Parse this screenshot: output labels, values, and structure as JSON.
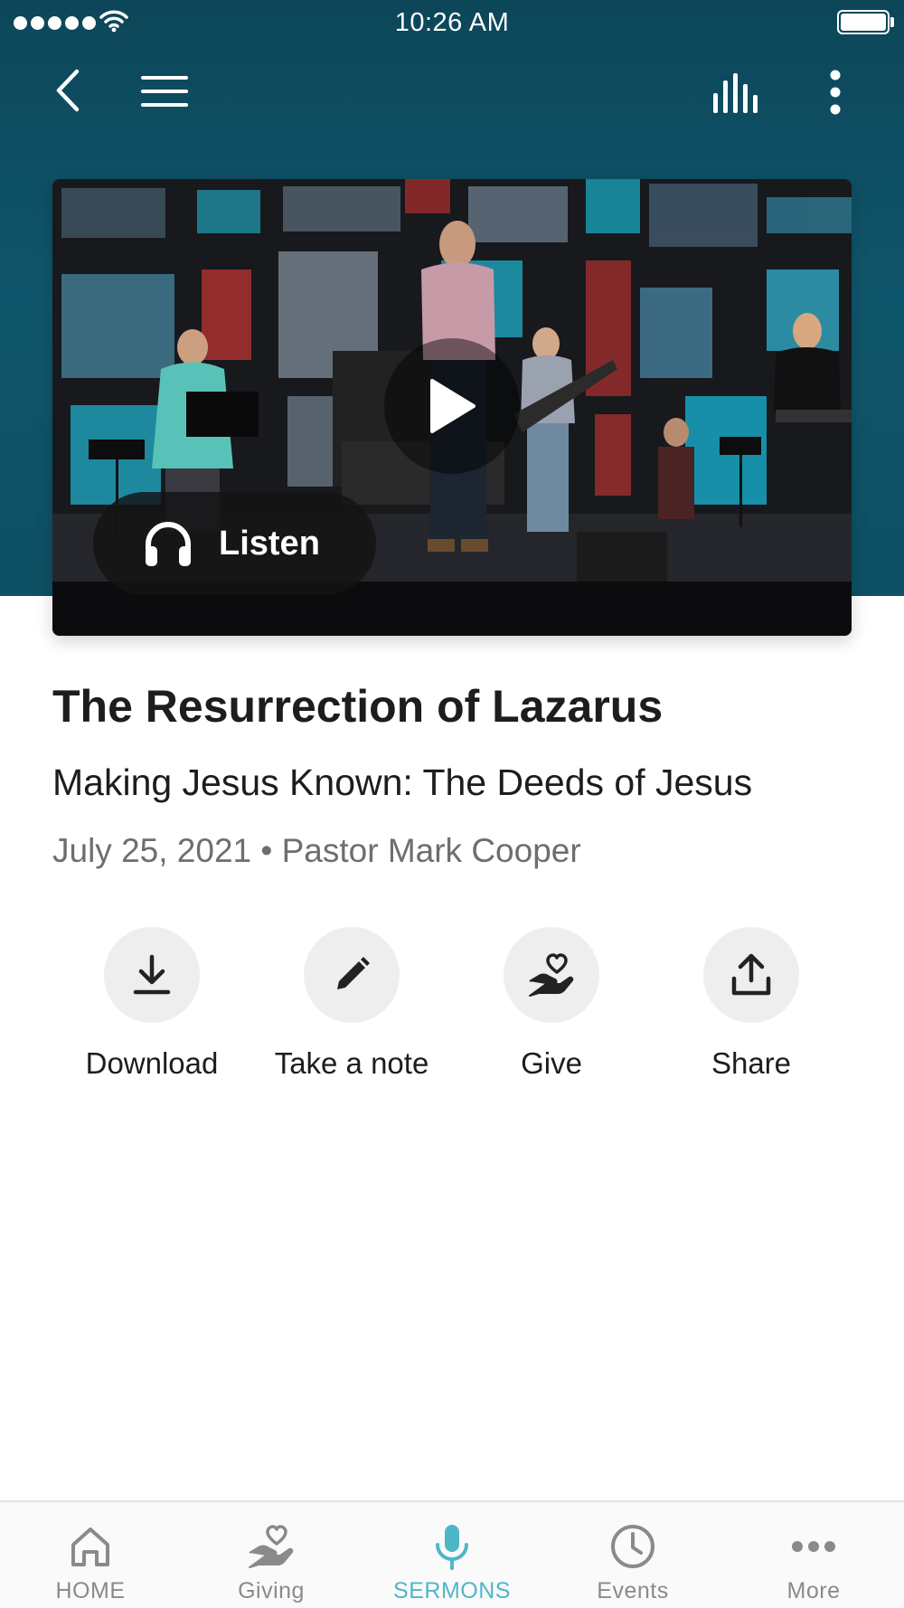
{
  "status_bar": {
    "time": "10:26 AM"
  },
  "colors": {
    "header": "#0f566c",
    "accent": "#4fb6c8",
    "inactive": "#8a8a8a"
  },
  "nav": {
    "icons": [
      "chevron-left-icon",
      "hamburger-menu-icon",
      "audio-bars-icon",
      "more-vertical-icon"
    ]
  },
  "video": {
    "listen_label": "Listen",
    "play_icon": "play-icon",
    "listen_icon": "headphones-icon"
  },
  "sermon": {
    "title": "The Resurrection of Lazarus",
    "series": "Making Jesus Known: The Deeds of Jesus",
    "meta": "July 25, 2021 • Pastor Mark Cooper"
  },
  "actions": [
    {
      "label": "Download",
      "icon": "download-icon"
    },
    {
      "label": "Take a note",
      "icon": "pencil-icon"
    },
    {
      "label": "Give",
      "icon": "hand-heart-icon"
    },
    {
      "label": "Share",
      "icon": "share-icon"
    }
  ],
  "tabs": [
    {
      "label": "HOME",
      "icon": "home-icon",
      "active": false
    },
    {
      "label": "Giving",
      "icon": "hand-heart-icon",
      "active": false
    },
    {
      "label": "SERMONS",
      "icon": "microphone-icon",
      "active": true
    },
    {
      "label": "Events",
      "icon": "clock-icon",
      "active": false
    },
    {
      "label": "More",
      "icon": "more-horizontal-icon",
      "active": false
    }
  ]
}
